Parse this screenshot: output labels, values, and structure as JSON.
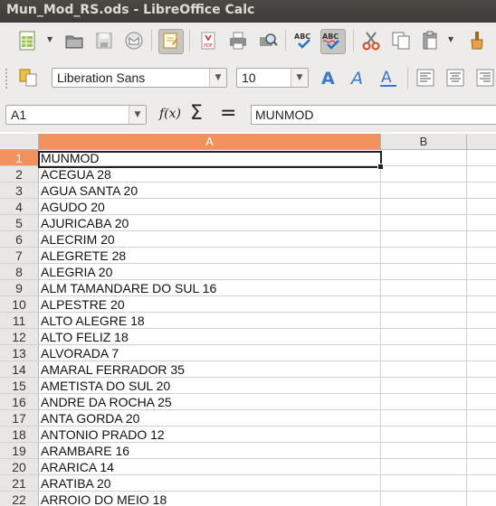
{
  "window": {
    "title": "Mun_Mod_RS.ods - LibreOffice Calc"
  },
  "toolbar": {
    "font_name": "Liberation Sans",
    "font_size": "10"
  },
  "formula_bar": {
    "name_box": "A1",
    "content": "MUNMOD",
    "fx_label": "f(x)",
    "sum_label": "Σ",
    "equals_label": "="
  },
  "sheet": {
    "columns": [
      "A",
      "B"
    ],
    "rows": [
      {
        "num": "1",
        "a": "MUNMOD"
      },
      {
        "num": "2",
        "a": "ACEGUA 28"
      },
      {
        "num": "3",
        "a": "AGUA SANTA 20"
      },
      {
        "num": "4",
        "a": "AGUDO 20"
      },
      {
        "num": "5",
        "a": "AJURICABA 20"
      },
      {
        "num": "6",
        "a": "ALECRIM 20"
      },
      {
        "num": "7",
        "a": "ALEGRETE 28"
      },
      {
        "num": "8",
        "a": "ALEGRIA 20"
      },
      {
        "num": "9",
        "a": "ALM TAMANDARE DO SUL 16"
      },
      {
        "num": "10",
        "a": "ALPESTRE 20"
      },
      {
        "num": "11",
        "a": "ALTO ALEGRE 18"
      },
      {
        "num": "12",
        "a": "ALTO FELIZ 18"
      },
      {
        "num": "13",
        "a": "ALVORADA 7"
      },
      {
        "num": "14",
        "a": "AMARAL FERRADOR 35"
      },
      {
        "num": "15",
        "a": "AMETISTA DO SUL 20"
      },
      {
        "num": "16",
        "a": "ANDRE DA ROCHA 25"
      },
      {
        "num": "17",
        "a": "ANTA GORDA 20"
      },
      {
        "num": "18",
        "a": "ANTONIO PRADO 12"
      },
      {
        "num": "19",
        "a": "ARAMBARE 16"
      },
      {
        "num": "20",
        "a": "ARARICA 14"
      },
      {
        "num": "21",
        "a": "ARATIBA 20"
      },
      {
        "num": "22",
        "a": "ARROIO DO MEIO 18"
      }
    ]
  },
  "colors": {
    "selection_header": "#f0915e",
    "titlebar": "#3c3b37"
  }
}
